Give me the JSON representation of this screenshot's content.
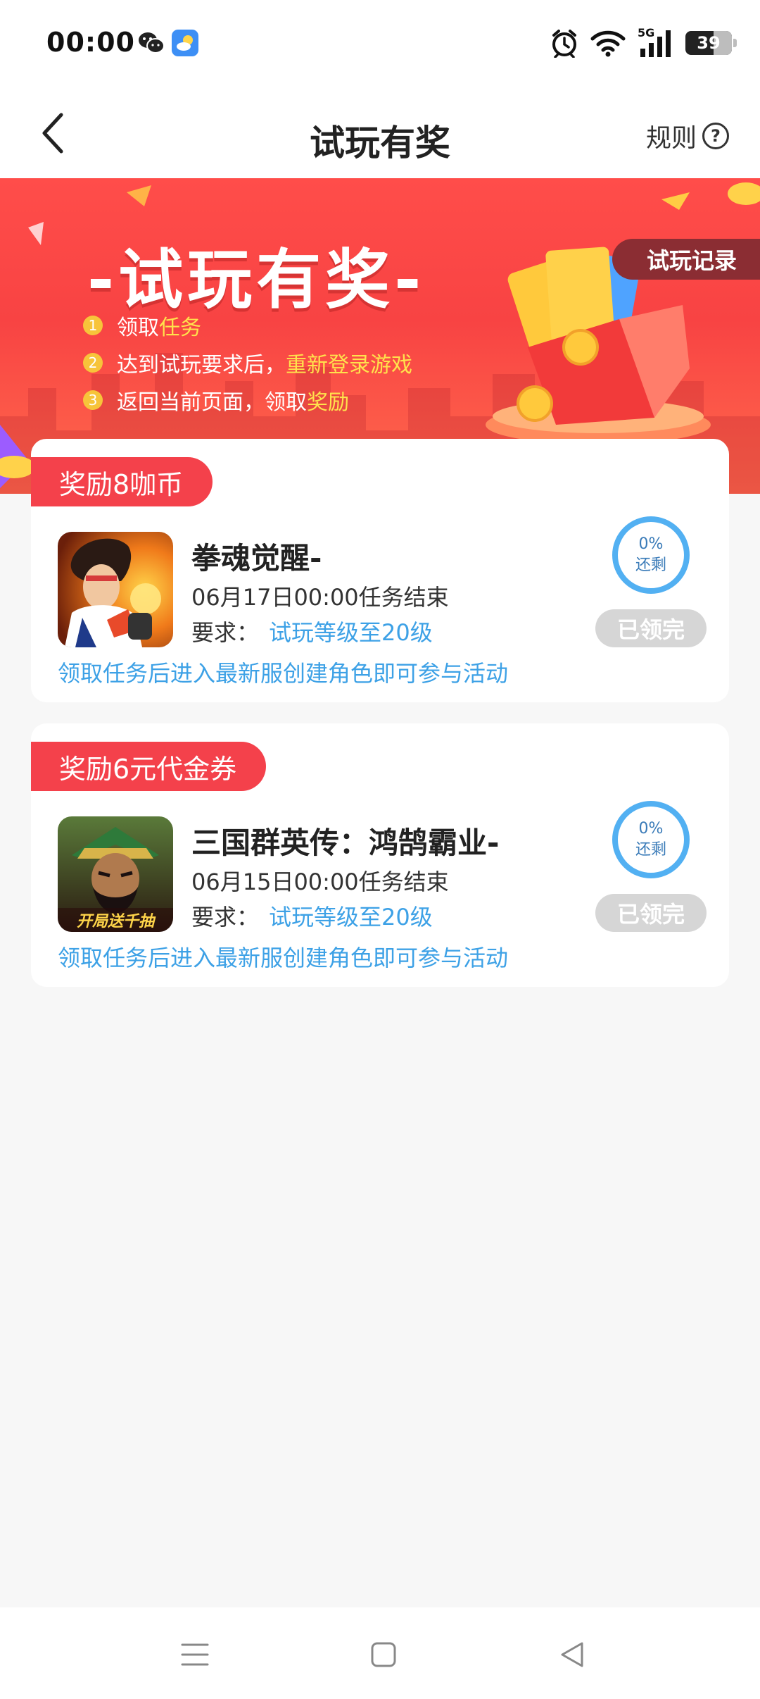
{
  "status_bar": {
    "time": "00:00",
    "network": "5G",
    "battery": "39",
    "icons": [
      "wechat-icon",
      "weather-icon",
      "alarm-icon",
      "wifi-icon",
      "signal-icon",
      "battery-icon"
    ]
  },
  "header": {
    "title": "试玩有奖",
    "rules_label": "规则",
    "rules_icon": "?"
  },
  "banner": {
    "title": "-试玩有奖-",
    "record_label": "试玩记录",
    "steps": [
      {
        "num": "1",
        "text": "领取",
        "highlight": "任务"
      },
      {
        "num": "2",
        "text": "达到试玩要求后，",
        "highlight": "重新登录游戏"
      },
      {
        "num": "3",
        "text": "返回当前页面，领取",
        "highlight": "奖励"
      }
    ]
  },
  "tasks": [
    {
      "reward": "奖励8咖币",
      "name": "拳魂觉醒-",
      "end_time": "06月17日00:00任务结束",
      "req_label": "要求：",
      "req_value": "试玩等级至20级",
      "note": "领取任务后进入最新服创建角色即可参与活动",
      "progress_percent": "0%",
      "progress_label": "还剩",
      "status": "已领完"
    },
    {
      "reward": "奖励6元代金券",
      "name": "三国群英传：鸿鹄霸业-",
      "end_time": "06月15日00:00任务结束",
      "req_label": "要求：",
      "req_value": "试玩等级至20级",
      "note": "领取任务后进入最新服创建角色即可参与活动",
      "progress_percent": "0%",
      "progress_label": "还剩",
      "status": "已领完",
      "icon_caption": "开局送千抽"
    }
  ],
  "colors": {
    "accent_red": "#f4414b",
    "link_blue": "#3da1e6",
    "highlight_yellow": "#ffe24c"
  }
}
